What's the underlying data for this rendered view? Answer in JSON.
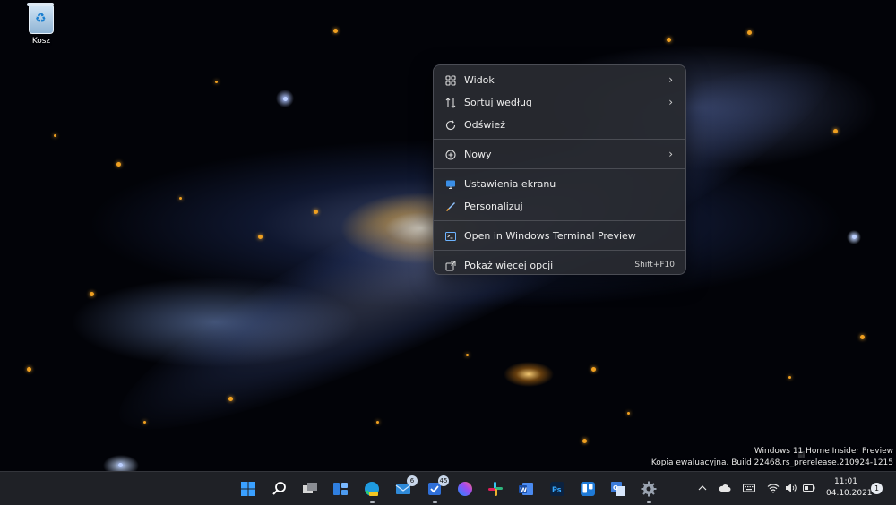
{
  "desktop": {
    "icons": [
      {
        "label": "Kosz",
        "icon": "recycle-bin-icon"
      }
    ]
  },
  "context_menu": {
    "items": [
      {
        "label": "Widok",
        "icon": "view-grid-icon",
        "submenu": true
      },
      {
        "label": "Sortuj według",
        "icon": "sort-icon",
        "submenu": true
      },
      {
        "label": "Odśwież",
        "icon": "refresh-icon",
        "submenu": false
      },
      {
        "label": "Nowy",
        "icon": "new-plus-icon",
        "submenu": true
      },
      {
        "label": "Ustawienia ekranu",
        "icon": "display-settings-icon",
        "submenu": false
      },
      {
        "label": "Personalizuj",
        "icon": "brush-icon",
        "submenu": false
      },
      {
        "label": "Open in Windows Terminal Preview",
        "icon": "terminal-icon",
        "submenu": false
      },
      {
        "label": "Pokaż więcej opcji",
        "icon": "more-options-icon",
        "shortcut": "Shift+F10"
      }
    ]
  },
  "watermark": {
    "line1": "Windows 11 Home Insider Preview",
    "line2": "Kopia ewaluacyjna. Build 22468.rs_prerelease.210924-1215"
  },
  "taskbar": {
    "apps": [
      {
        "name": "start",
        "icon": "windows-start-icon",
        "color": "#3aa0ff"
      },
      {
        "name": "search",
        "icon": "search-icon",
        "color": "#ffffff"
      },
      {
        "name": "task-view",
        "icon": "task-view-icon",
        "color": "#d0d0d0"
      },
      {
        "name": "widgets",
        "icon": "widgets-icon",
        "color": "#2f7fe0"
      },
      {
        "name": "edge-canary",
        "icon": "edge-canary-icon",
        "color": "#2bbf6a"
      },
      {
        "name": "mail",
        "icon": "mail-icon",
        "color": "#2f8ad8",
        "badge": "6"
      },
      {
        "name": "todo",
        "icon": "todo-icon",
        "color": "#2f6fd8",
        "badge": "45"
      },
      {
        "name": "messenger",
        "icon": "messenger-icon",
        "color": "#a04bf0"
      },
      {
        "name": "slack",
        "icon": "slack-icon",
        "color": "#e8b020"
      },
      {
        "name": "word",
        "icon": "word-icon",
        "color": "#2b5fbd"
      },
      {
        "name": "photoshop",
        "icon": "photoshop-icon",
        "color": "#0b2240"
      },
      {
        "name": "trello",
        "icon": "trello-icon",
        "color": "#1f7ad6"
      },
      {
        "name": "translator",
        "icon": "translator-icon",
        "color": "#3c7bd9"
      },
      {
        "name": "settings",
        "icon": "settings-gear-icon",
        "color": "#9aa3b0"
      }
    ],
    "tray": {
      "icons": [
        "chevron-up-icon",
        "onedrive-cloud-icon",
        "keyboard-icon",
        "wifi-icon",
        "volume-icon",
        "battery-icon"
      ],
      "time": "11:01",
      "date": "04.10.2021",
      "notifications": "1"
    }
  }
}
